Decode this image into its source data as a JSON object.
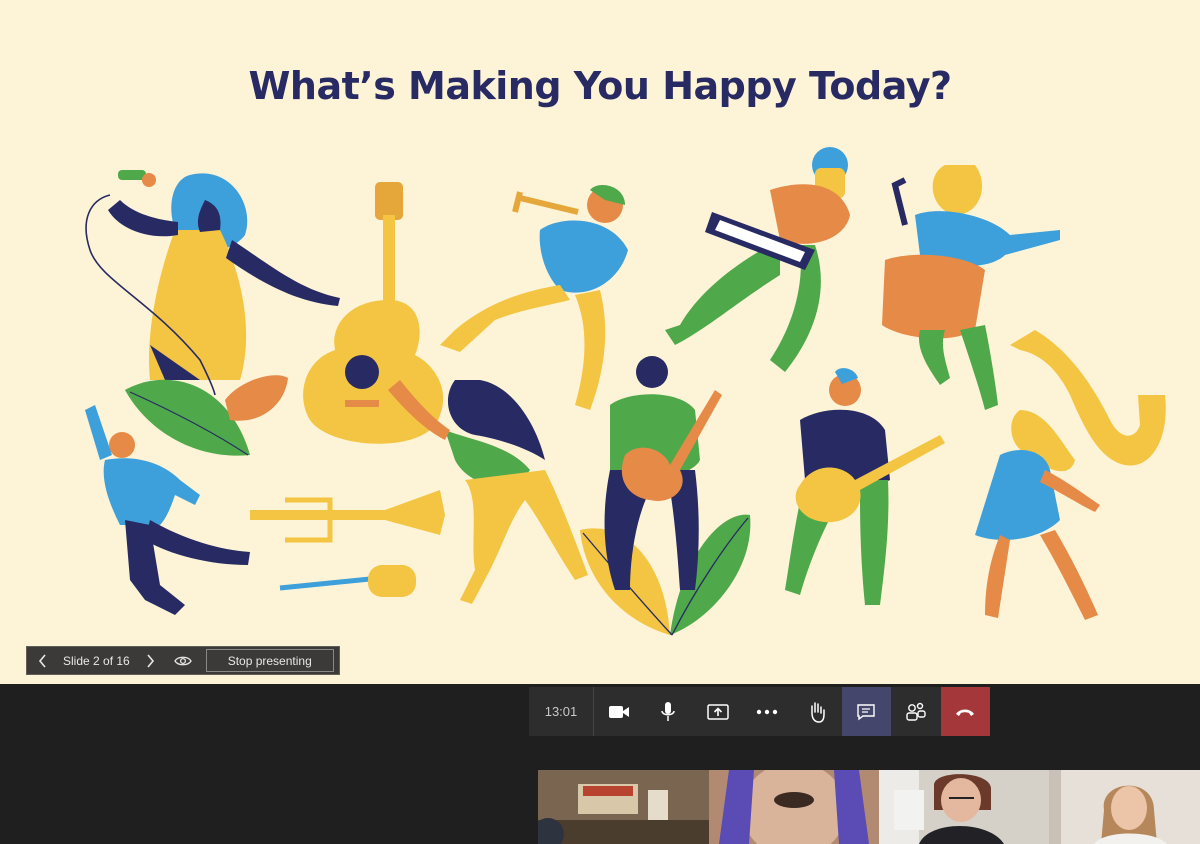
{
  "slide": {
    "title": "What’s Making You Happy Today?",
    "colors": {
      "background": "#fdf3d7",
      "title": "#272a63",
      "yellow": "#f4c542",
      "navy": "#272a63",
      "blue": "#3da0db",
      "green": "#4fa84a",
      "orange": "#e58a47"
    }
  },
  "presenter": {
    "prev_icon": "chevron-left-icon",
    "counter": "Slide 2 of 16",
    "next_icon": "chevron-right-icon",
    "view_icon": "eye-icon",
    "stop_label": "Stop presenting"
  },
  "call": {
    "timer": "13:01",
    "buttons": [
      "camera-icon",
      "microphone-icon",
      "share-screen-icon",
      "more-options-icon",
      "raise-hand-icon",
      "chat-icon",
      "participants-icon",
      "hang-up-icon"
    ]
  },
  "participants": [
    {
      "id": "tile-1"
    },
    {
      "id": "tile-2"
    },
    {
      "id": "tile-3"
    },
    {
      "id": "tile-4"
    }
  ]
}
